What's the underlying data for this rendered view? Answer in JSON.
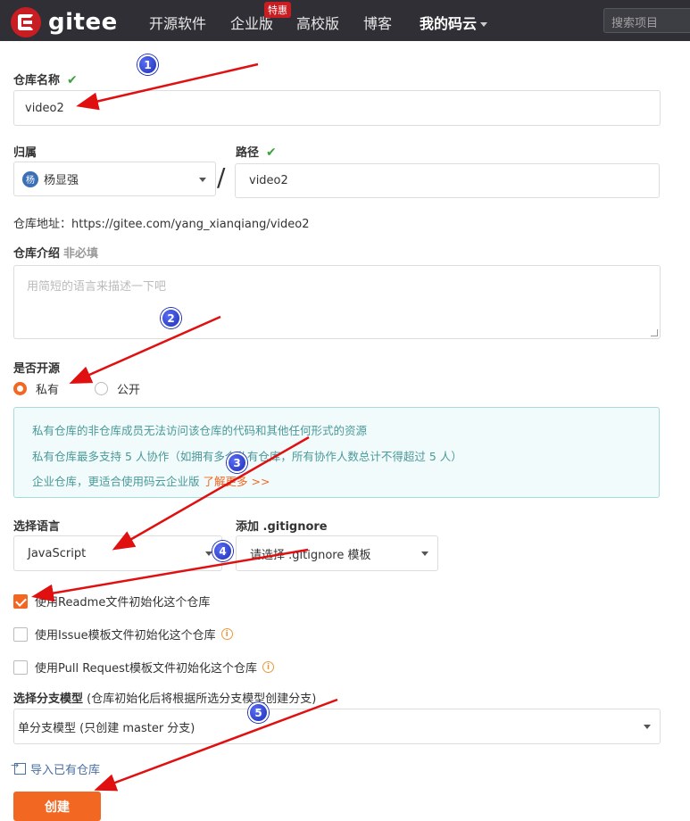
{
  "nav": {
    "logo_text": "gitee",
    "items": [
      "开源软件",
      "企业版",
      "高校版",
      "博客",
      "我的码云"
    ],
    "hot_badge": "特惠",
    "search_placeholder": "搜索项目"
  },
  "form": {
    "repo_name_label": "仓库名称",
    "repo_name_value": "video2",
    "owner_label": "归属",
    "owner_avatar": "杨",
    "owner_value": "杨显强",
    "path_label": "路径",
    "path_value": "video2",
    "repo_address": "仓库地址：https://gitee.com/yang_xianqiang/video2",
    "intro_label": "仓库介绍",
    "intro_optional": "非必填",
    "intro_placeholder": "用简短的语言来描述一下吧",
    "open_source_label": "是否开源",
    "radio_private": "私有",
    "radio_public": "公开",
    "info_lines": [
      "私有仓库的非仓库成员无法访问该仓库的代码和其他任何形式的资源",
      "私有仓库最多支持 5 人协作（如拥有多个私有仓库，所有协作人数总计不得超过 5 人）",
      "企业仓库，更适合使用码云企业版"
    ],
    "learn_more": "了解更多 >>",
    "language_label": "选择语言",
    "language_value": "JavaScript",
    "gitignore_label": "添加 .gitignore",
    "gitignore_value": "请选择 .gitignore 模板",
    "cb_readme": "使用Readme文件初始化这个仓库",
    "cb_issue": "使用Issue模板文件初始化这个仓库",
    "cb_pr": "使用Pull Request模板文件初始化这个仓库",
    "branch_label": "选择分支模型",
    "branch_hint": " (仓库初始化后将根据所选分支模型创建分支)",
    "branch_value": "单分支模型 (只创建 master 分支)",
    "import_link": "导入已有仓库",
    "create_button": "创建"
  },
  "state": {
    "private_selected": true,
    "readme_checked": true,
    "issue_checked": false,
    "pr_checked": false
  },
  "annotations": [
    "1",
    "2",
    "3",
    "4",
    "5"
  ],
  "colors": {
    "accent": "#f26722",
    "nav_bg": "#2f2f35",
    "brand_red": "#c71d23",
    "arrow_red": "#e01010",
    "marker_blue": "#1d2fb8"
  }
}
